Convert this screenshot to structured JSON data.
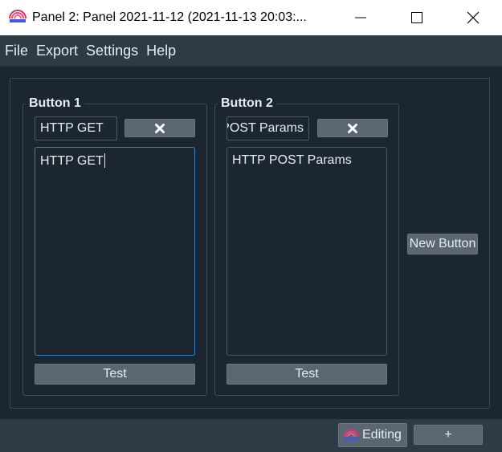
{
  "window": {
    "title": "Panel 2: Panel 2021-11-12 (2021-11-13 20:03:...",
    "icons": {
      "app": "broadcast-icon",
      "minimize": "minimize-icon",
      "maximize": "maximize-icon",
      "close": "close-icon"
    }
  },
  "menu": {
    "items": [
      {
        "label": "File"
      },
      {
        "label": "Export"
      },
      {
        "label": "Settings"
      },
      {
        "label": "Help"
      }
    ]
  },
  "buttons": [
    {
      "title": "Button 1",
      "name_value": "HTTP GET",
      "delete_icon": "heavy-x-icon",
      "content": "HTTP GET",
      "test_label": "Test"
    },
    {
      "title": "Button 2",
      "name_value": "HTTP POST Params",
      "delete_icon": "heavy-x-icon",
      "content": "HTTP POST Params",
      "test_label": "Test"
    }
  ],
  "new_button_label": "New Button",
  "statusbar": {
    "editing_label": "Editing",
    "plus_label": "+"
  },
  "colors": {
    "background": "#1b2631",
    "menubar": "#2e3a46",
    "button": "#5a6772",
    "focus_border": "#3b7fc4"
  }
}
